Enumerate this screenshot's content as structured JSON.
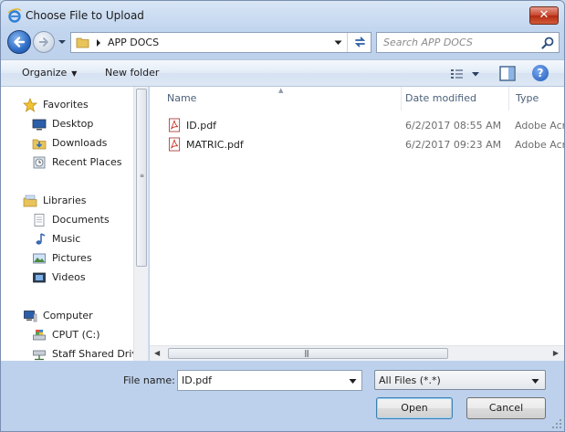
{
  "window": {
    "title": "Choose File to Upload",
    "close_label": "✕"
  },
  "address": {
    "path": "APP DOCS"
  },
  "search": {
    "placeholder": "Search APP DOCS"
  },
  "toolbar": {
    "organize": "Organize",
    "new_folder": "New folder",
    "help": "?"
  },
  "nav": {
    "groups": [
      {
        "label": "Favorites",
        "icon": "star-icon",
        "items": [
          {
            "label": "Desktop",
            "icon": "desktop-icon"
          },
          {
            "label": "Downloads",
            "icon": "downloads-icon"
          },
          {
            "label": "Recent Places",
            "icon": "recent-places-icon"
          }
        ]
      },
      {
        "label": "Libraries",
        "icon": "libraries-icon",
        "items": [
          {
            "label": "Documents",
            "icon": "documents-icon"
          },
          {
            "label": "Music",
            "icon": "music-icon"
          },
          {
            "label": "Pictures",
            "icon": "pictures-icon"
          },
          {
            "label": "Videos",
            "icon": "videos-icon"
          }
        ]
      },
      {
        "label": "Computer",
        "icon": "computer-icon",
        "items": [
          {
            "label": "CPUT (C:)",
            "icon": "drive-icon"
          },
          {
            "label": "Staff Shared Drive",
            "icon": "network-drive-icon"
          }
        ]
      }
    ]
  },
  "columns": {
    "name": "Name",
    "date": "Date modified",
    "type": "Type"
  },
  "files": [
    {
      "name": "ID.pdf",
      "date": "6/2/2017 08:55 AM",
      "type": "Adobe Acrobat Document",
      "icon": "pdf-icon"
    },
    {
      "name": "MATRIC.pdf",
      "date": "6/2/2017 09:23 AM",
      "type": "Adobe Acrobat Document",
      "icon": "pdf-icon"
    }
  ],
  "footer": {
    "filename_label": "File name:",
    "filename_value": "ID.pdf",
    "filetype_value": "All Files (*.*)",
    "open_label": "Open",
    "cancel_label": "Cancel"
  }
}
